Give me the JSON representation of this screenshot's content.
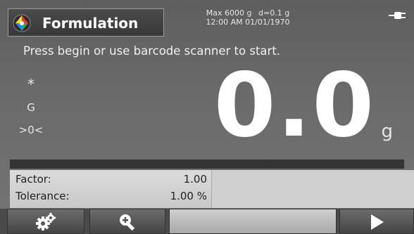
{
  "header": {
    "app_title": "Formulation",
    "capacity": "Max 6000 g",
    "readability": "d=0.1 g",
    "datetime": "12:00 AM 01/01/1970"
  },
  "prompt": "Press begin or use barcode scanner to start.",
  "indicators": {
    "stable": "*",
    "gross": "G",
    "zero": ">0<"
  },
  "reading": {
    "value": "0.0",
    "unit": "g"
  },
  "progress": 0,
  "info": {
    "factor_label": "Factor:",
    "factor_value": "1.00",
    "tolerance_label": "Tolerance:",
    "tolerance_value": "1.00 %"
  },
  "softkeys": [
    "settings-icon",
    "zoom-in-icon",
    "empty",
    "play-icon"
  ],
  "icons": {
    "app": "formulation-icon",
    "power": "ac-power-icon"
  }
}
